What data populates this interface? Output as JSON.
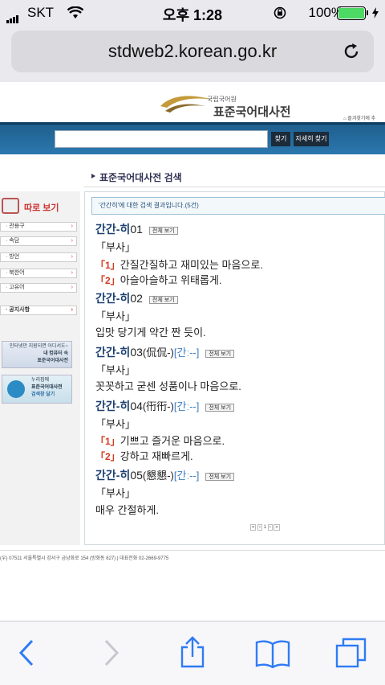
{
  "status": {
    "carrier": "SKT",
    "time": "오후 1:28",
    "battery": "100%"
  },
  "browser": {
    "url": "stdweb2.korean.go.kr"
  },
  "site": {
    "org": "국립국어원",
    "title": "표준국어대사전",
    "bookmark": "즐겨찾기에 추",
    "search_btn": "찾기",
    "detail_btn": "자세히 찾기",
    "section_title": "표준국어대사전 검색"
  },
  "left": {
    "quick_title": "따로 보기",
    "items": [
      "관용구",
      "속담",
      "방언",
      "북한어",
      "고유어"
    ],
    "notice": "공지사항",
    "promo1": {
      "line1": "인터넷만 지원되면 어디서도~",
      "line2": "내 컴퓨터 속",
      "line3": "표준국어대사전"
    },
    "promo2": {
      "line1": "누리집에",
      "line2": "표준국어대사전",
      "line3": "검색창 달기"
    }
  },
  "results": {
    "header": "'간간히'에 대한 검색 결과입니다.(5건)",
    "full_view": "전체 보기",
    "entries": [
      {
        "hw": "간간-히",
        "num": "01",
        "origin": "",
        "pron": "",
        "pos": "「부사」",
        "senses": [
          {
            "n": "「1」",
            "t": "간질간질하고 재미있는 마음으로."
          },
          {
            "n": "「2」",
            "t": "아슬아슬하고 위태롭게."
          }
        ]
      },
      {
        "hw": "간간-히",
        "num": "02",
        "origin": "",
        "pron": "",
        "pos": "「부사」",
        "senses": [
          {
            "n": "",
            "t": "입맛 당기게 약간 짠 듯이."
          }
        ]
      },
      {
        "hw": "간간-히",
        "num": "03",
        "origin": "(侃侃-)",
        "pron": "[간ː--]",
        "pos": "「부사」",
        "senses": [
          {
            "n": "",
            "t": "꼿꼿하고 굳센 성품이나 마음으로."
          }
        ]
      },
      {
        "hw": "간간-히",
        "num": "04",
        "origin": "(衎衎-)",
        "pron": "[간ː--]",
        "pos": "「부사」",
        "senses": [
          {
            "n": "「1」",
            "t": "기쁘고 즐거운 마음으로."
          },
          {
            "n": "「2」",
            "t": "강하고 재빠르게."
          }
        ]
      },
      {
        "hw": "간간-히",
        "num": "05",
        "origin": "(懇懇-)",
        "pron": "[간ː--]",
        "pos": "「부사」",
        "senses": [
          {
            "n": "",
            "t": "매우 간절하게."
          }
        ]
      }
    ],
    "pager": "1"
  },
  "footer": "(우) 07511 서울특별시 강서구 금낭화로 154 (방화동 827) | 대표전화 02-2669-9775"
}
